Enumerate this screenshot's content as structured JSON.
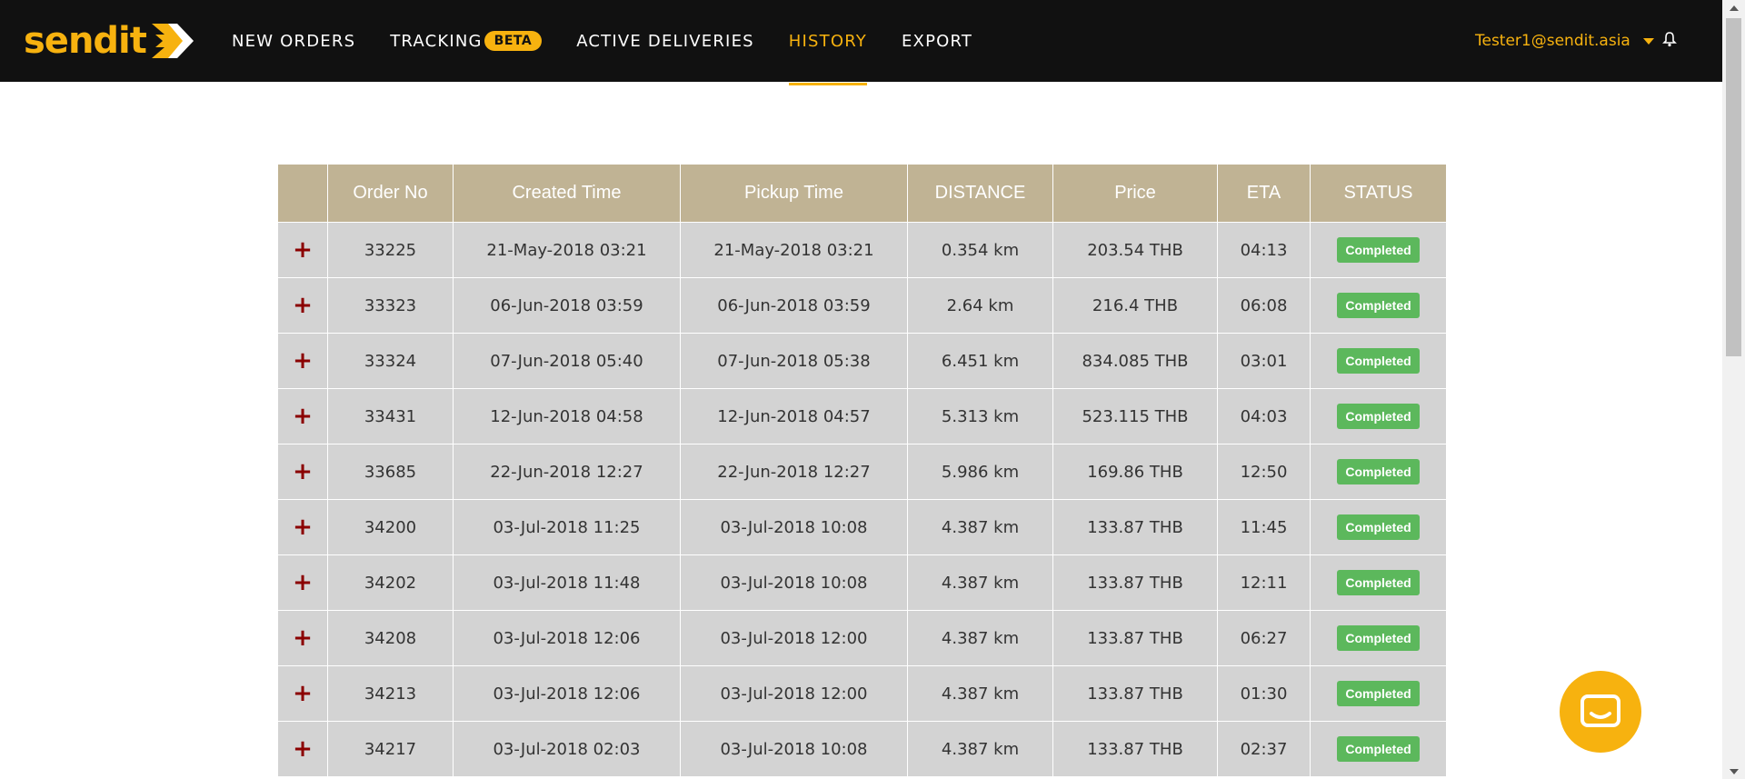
{
  "brand": {
    "name": "sendit"
  },
  "nav": {
    "items": [
      {
        "label": "NEW ORDERS"
      },
      {
        "label": "TRACKING",
        "badge": "BETA"
      },
      {
        "label": "ACTIVE DELIVERIES"
      },
      {
        "label": "HISTORY",
        "active": true
      },
      {
        "label": "EXPORT"
      }
    ]
  },
  "user": {
    "email": "Tester1@sendit.asia"
  },
  "colors": {
    "accent": "#f7b20f",
    "header_bg": "#c0b394",
    "status_green": "#5cb85c",
    "plus_red": "#8b0000"
  },
  "table": {
    "headers": [
      "",
      "Order No",
      "Created Time",
      "Pickup Time",
      "DISTANCE",
      "Price",
      "ETA",
      "STATUS"
    ],
    "rows": [
      {
        "expand": "+",
        "order": "33225",
        "created": "21-May-2018 03:21",
        "pickup": "21-May-2018 03:21",
        "distance": "0.354 km",
        "price": "203.54 THB",
        "eta": "04:13",
        "status": "Completed"
      },
      {
        "expand": "+",
        "order": "33323",
        "created": "06-Jun-2018 03:59",
        "pickup": "06-Jun-2018 03:59",
        "distance": "2.64 km",
        "price": "216.4 THB",
        "eta": "06:08",
        "status": "Completed"
      },
      {
        "expand": "+",
        "order": "33324",
        "created": "07-Jun-2018 05:40",
        "pickup": "07-Jun-2018 05:38",
        "distance": "6.451 km",
        "price": "834.085 THB",
        "eta": "03:01",
        "status": "Completed"
      },
      {
        "expand": "+",
        "order": "33431",
        "created": "12-Jun-2018 04:58",
        "pickup": "12-Jun-2018 04:57",
        "distance": "5.313 km",
        "price": "523.115 THB",
        "eta": "04:03",
        "status": "Completed"
      },
      {
        "expand": "+",
        "order": "33685",
        "created": "22-Jun-2018 12:27",
        "pickup": "22-Jun-2018 12:27",
        "distance": "5.986 km",
        "price": "169.86 THB",
        "eta": "12:50",
        "status": "Completed"
      },
      {
        "expand": "+",
        "order": "34200",
        "created": "03-Jul-2018 11:25",
        "pickup": "03-Jul-2018 10:08",
        "distance": "4.387 km",
        "price": "133.87 THB",
        "eta": "11:45",
        "status": "Completed"
      },
      {
        "expand": "+",
        "order": "34202",
        "created": "03-Jul-2018 11:48",
        "pickup": "03-Jul-2018 10:08",
        "distance": "4.387 km",
        "price": "133.87 THB",
        "eta": "12:11",
        "status": "Completed"
      },
      {
        "expand": "+",
        "order": "34208",
        "created": "03-Jul-2018 12:06",
        "pickup": "03-Jul-2018 12:00",
        "distance": "4.387 km",
        "price": "133.87 THB",
        "eta": "06:27",
        "status": "Completed"
      },
      {
        "expand": "+",
        "order": "34213",
        "created": "03-Jul-2018 12:06",
        "pickup": "03-Jul-2018 12:00",
        "distance": "4.387 km",
        "price": "133.87 THB",
        "eta": "01:30",
        "status": "Completed"
      },
      {
        "expand": "+",
        "order": "34217",
        "created": "03-Jul-2018 02:03",
        "pickup": "03-Jul-2018 10:08",
        "distance": "4.387 km",
        "price": "133.87 THB",
        "eta": "02:37",
        "status": "Completed"
      }
    ]
  },
  "icons": {
    "bell": "bell-icon",
    "chat": "chat-icon",
    "dropdown": "caret-down-icon"
  }
}
